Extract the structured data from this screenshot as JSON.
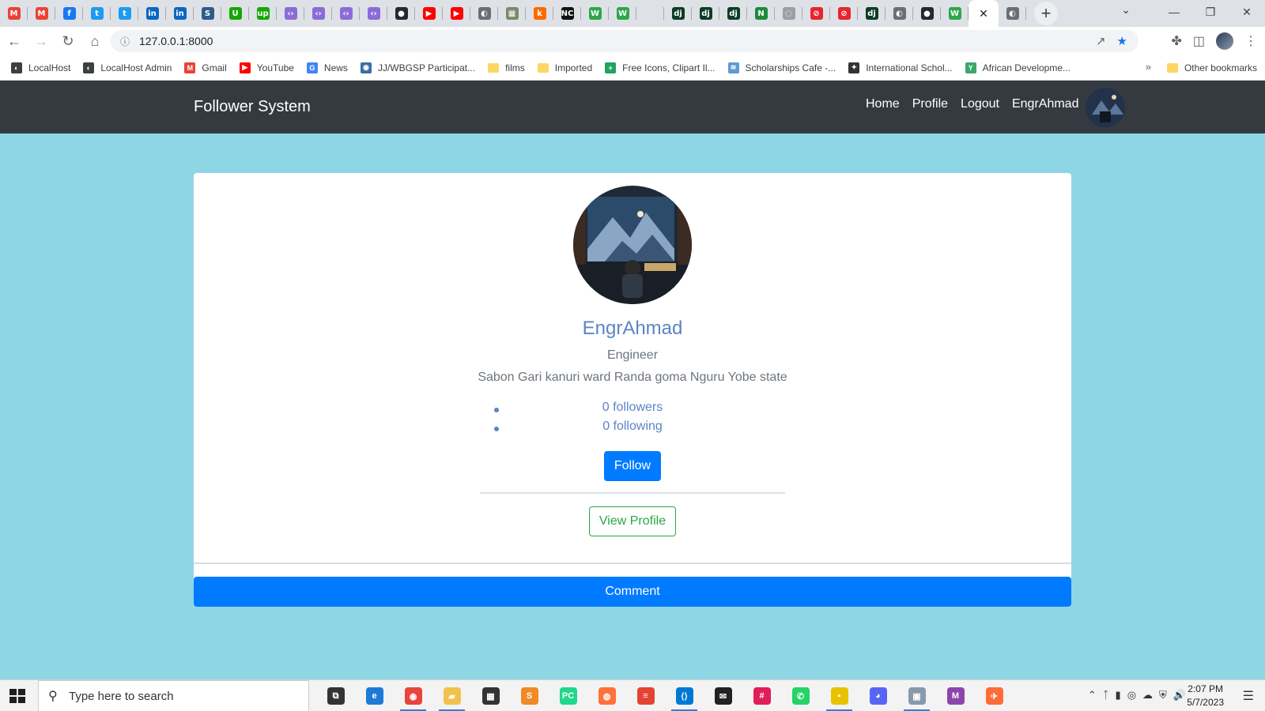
{
  "browser": {
    "tabs": [
      {
        "icon": "gmail-icon",
        "glyph": "M",
        "color": "#ea4335"
      },
      {
        "icon": "gmail-icon",
        "glyph": "M",
        "color": "#ea4335"
      },
      {
        "icon": "facebook-icon",
        "glyph": "f",
        "color": "#1877f2"
      },
      {
        "icon": "twitter-icon",
        "glyph": "t",
        "color": "#1d9bf0"
      },
      {
        "icon": "twitter-icon",
        "glyph": "t",
        "color": "#1d9bf0"
      },
      {
        "icon": "linkedin-icon",
        "glyph": "in",
        "color": "#0a66c2"
      },
      {
        "icon": "linkedin-icon",
        "glyph": "in",
        "color": "#0a66c2"
      },
      {
        "icon": "scholarship-icon",
        "glyph": "S",
        "color": "#2e5c8a"
      },
      {
        "icon": "upwork-icon",
        "glyph": "U",
        "color": "#14a800"
      },
      {
        "icon": "upwork-icon",
        "glyph": "up",
        "color": "#14a800"
      },
      {
        "icon": "code-icon",
        "glyph": "‹›",
        "color": "#8a6cd9"
      },
      {
        "icon": "code-icon",
        "glyph": "‹›",
        "color": "#8a6cd9"
      },
      {
        "icon": "code-icon",
        "glyph": "‹›",
        "color": "#8a6cd9"
      },
      {
        "icon": "code-icon",
        "glyph": "‹›",
        "color": "#8a6cd9"
      },
      {
        "icon": "github-icon",
        "glyph": "●",
        "color": "#24292f"
      },
      {
        "icon": "youtube-icon",
        "glyph": "▶",
        "color": "#ff0000"
      },
      {
        "icon": "youtube-icon",
        "glyph": "▶",
        "color": "#ff0000"
      },
      {
        "icon": "globe-icon",
        "glyph": "◐",
        "color": "#6b6f74"
      },
      {
        "icon": "image-icon",
        "glyph": "▦",
        "color": "#7a8a6a"
      },
      {
        "icon": "k-icon",
        "glyph": "k",
        "color": "#ff6a00"
      },
      {
        "icon": "nc-icon",
        "glyph": "NC",
        "color": "#111111"
      },
      {
        "icon": "w-icon",
        "glyph": "W",
        "color": "#2aa84a"
      },
      {
        "icon": "w-icon",
        "glyph": "W",
        "color": "#2aa84a"
      },
      {
        "icon": "blank-icon",
        "glyph": "",
        "color": "#dee1e6"
      },
      {
        "icon": "django-icon",
        "glyph": "dj",
        "color": "#0c3c26"
      },
      {
        "icon": "django-icon",
        "glyph": "dj",
        "color": "#0c3c26"
      },
      {
        "icon": "django-icon",
        "glyph": "dj",
        "color": "#0c3c26"
      },
      {
        "icon": "n-icon",
        "glyph": "N",
        "color": "#1f8a3c"
      },
      {
        "icon": "loading-icon",
        "glyph": "◌",
        "color": "#9aa0a6"
      },
      {
        "icon": "opera-icon",
        "glyph": "⊘",
        "color": "#e8242c"
      },
      {
        "icon": "opera-icon",
        "glyph": "⊘",
        "color": "#e8242c"
      },
      {
        "icon": "django-icon",
        "glyph": "dj",
        "color": "#0c3c26"
      },
      {
        "icon": "globe-icon",
        "glyph": "◐",
        "color": "#6b6f74"
      },
      {
        "icon": "github-icon",
        "glyph": "●",
        "color": "#24292f"
      },
      {
        "icon": "w-icon",
        "glyph": "W",
        "color": "#2aa84a"
      }
    ],
    "address": "127.0.0.1:8000",
    "bookmarks": [
      {
        "label": "LocalHost",
        "color": "#3c4043",
        "glyph": "◐"
      },
      {
        "label": "LocalHost Admin",
        "color": "#3c4043",
        "glyph": "◐"
      },
      {
        "label": "Gmail",
        "color": "#ea4335",
        "glyph": "M"
      },
      {
        "label": "YouTube",
        "color": "#ff0000",
        "glyph": "▶"
      },
      {
        "label": "News",
        "color": "#4285f4",
        "glyph": "G"
      },
      {
        "label": "JJ/WBGSP Participat...",
        "color": "#3a6ea5",
        "glyph": "◉"
      },
      {
        "label": "films",
        "color": "folder",
        "glyph": ""
      },
      {
        "label": "Imported",
        "color": "folder",
        "glyph": ""
      },
      {
        "label": "Free Icons, Clipart Il...",
        "color": "#1ea362",
        "glyph": "+"
      },
      {
        "label": "Scholarships Cafe -...",
        "color": "#5a9bd5",
        "glyph": "≋"
      },
      {
        "label": "International Schol...",
        "color": "#333333",
        "glyph": "✦"
      },
      {
        "label": "African Developme...",
        "color": "#3aa86b",
        "glyph": "Y"
      }
    ],
    "other_bookmarks": "Other bookmarks"
  },
  "app": {
    "brand": "Follower System",
    "nav": {
      "home": "Home",
      "profile": "Profile",
      "logout": "Logout",
      "username": "EngrAhmad"
    }
  },
  "profile": {
    "name": "EngrAhmad",
    "occupation": "Engineer",
    "address": "Sabon Gari kanuri ward Randa goma Nguru Yobe state",
    "followers": "0 followers",
    "following": "0 following",
    "follow_label": "Follow",
    "view_profile_label": "View Profile",
    "comment_label": "Comment"
  },
  "colors": {
    "page_bg": "#8fd6e4",
    "navbar": "#343a40",
    "primary": "#007bff",
    "success": "#28a745",
    "link": "#5b84c4"
  },
  "taskbar": {
    "search_placeholder": "Type here to search",
    "apps": [
      {
        "icon": "task-view-icon",
        "glyph": "⧉",
        "color": "#333333",
        "open": false
      },
      {
        "icon": "edge-icon",
        "glyph": "e",
        "color": "#1e7ad6",
        "open": false
      },
      {
        "icon": "chrome-icon",
        "glyph": "◉",
        "color": "#e8453c",
        "open": true
      },
      {
        "icon": "file-explorer-icon",
        "glyph": "▰",
        "color": "#f2c14e",
        "open": true
      },
      {
        "icon": "store-icon",
        "glyph": "▦",
        "color": "#333333",
        "open": false
      },
      {
        "icon": "sublime-icon",
        "glyph": "S",
        "color": "#f08a24",
        "open": false
      },
      {
        "icon": "pycharm-icon",
        "glyph": "PC",
        "color": "#21d789",
        "open": false
      },
      {
        "icon": "firefox-icon",
        "glyph": "◍",
        "color": "#ff7139",
        "open": false
      },
      {
        "icon": "todoist-icon",
        "glyph": "≡",
        "color": "#e44332",
        "open": false
      },
      {
        "icon": "vscode-icon",
        "glyph": "⟨⟩",
        "color": "#0078d4",
        "open": true
      },
      {
        "icon": "mail-icon",
        "glyph": "✉",
        "color": "#222222",
        "open": false
      },
      {
        "icon": "slack-icon",
        "glyph": "#",
        "color": "#e01e5a",
        "open": false
      },
      {
        "icon": "whatsapp-icon",
        "glyph": "✆",
        "color": "#25d366",
        "open": false
      },
      {
        "icon": "sticky-notes-icon",
        "glyph": "▪",
        "color": "#e8c100",
        "open": true
      },
      {
        "icon": "discord-icon",
        "glyph": "◕",
        "color": "#5865f2",
        "open": false
      },
      {
        "icon": "photos-icon",
        "glyph": "▣",
        "color": "#8899aa",
        "open": true
      },
      {
        "icon": "m-icon",
        "glyph": "M",
        "color": "#8e44ad",
        "open": false
      },
      {
        "icon": "postman-icon",
        "glyph": "✈",
        "color": "#ff6c37",
        "open": false
      }
    ],
    "time": "2:07 PM",
    "date": "5/7/2023"
  }
}
